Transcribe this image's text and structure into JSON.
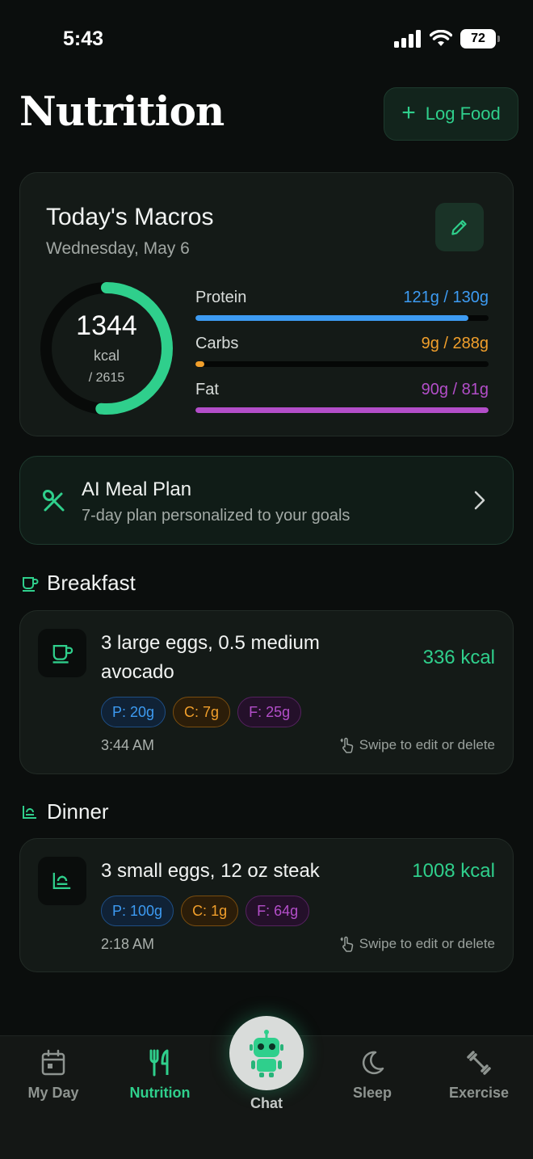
{
  "status": {
    "time": "5:43",
    "battery": "72"
  },
  "header": {
    "title": "Nutrition",
    "log_food_label": "Log Food"
  },
  "macros": {
    "title": "Today's Macros",
    "date": "Wednesday, May 6",
    "calories": {
      "value": "1344",
      "unit": "kcal",
      "goal": "/ 2615",
      "fraction": 0.514
    },
    "items": [
      {
        "name": "Protein",
        "value": "121g / 130g",
        "fraction": 0.93,
        "color": "#3d9bf2"
      },
      {
        "name": "Carbs",
        "value": "9g / 288g",
        "fraction": 0.03,
        "color": "#f19f2b"
      },
      {
        "name": "Fat",
        "value": "90g / 81g",
        "fraction": 1.0,
        "color": "#b34ec9"
      }
    ]
  },
  "meal_plan": {
    "title": "AI Meal Plan",
    "subtitle": "7-day plan personalized to your goals"
  },
  "meals": [
    {
      "section": "Breakfast",
      "name": "3 large eggs, 0.5 medium avocado",
      "kcal": "336 kcal",
      "protein": "P: 20g",
      "carbs": "C: 7g",
      "fat": "F: 25g",
      "time": "3:44 AM",
      "hint": "Swipe to edit or delete"
    },
    {
      "section": "Dinner",
      "name": "3 small eggs, 12 oz steak",
      "kcal": "1008 kcal",
      "protein": "P: 100g",
      "carbs": "C: 1g",
      "fat": "F: 64g",
      "time": "2:18 AM",
      "hint": "Swipe to edit or delete"
    }
  ],
  "nav": {
    "items": [
      {
        "label": "My Day",
        "icon": "calendar-icon"
      },
      {
        "label": "Nutrition",
        "icon": "fork-knife-icon",
        "active": true
      },
      {
        "label": "Chat",
        "icon": "robot-icon"
      },
      {
        "label": "Sleep",
        "icon": "moon-icon"
      },
      {
        "label": "Exercise",
        "icon": "dumbbell-icon"
      }
    ]
  },
  "colors": {
    "accent": "#2fcf8c",
    "protein": "#3d9bf2",
    "carbs": "#f19f2b",
    "fat": "#b34ec9",
    "background": "#0b0e0d"
  }
}
